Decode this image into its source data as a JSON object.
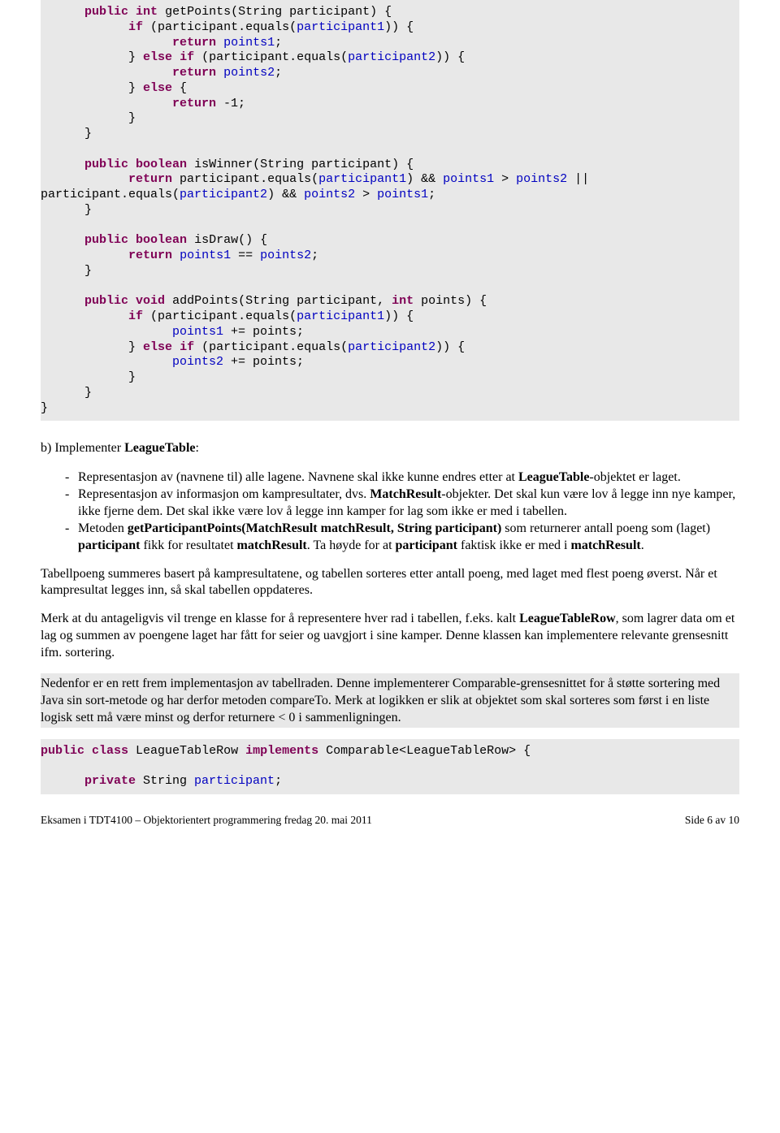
{
  "code1": {
    "l01a": "      ",
    "l01b": "public",
    "l01c": " ",
    "l01d": "int",
    "l01e": " getPoints(String participant) {",
    "l02a": "            ",
    "l02b": "if",
    "l02c": " (participant.equals(",
    "l02d": "participant1",
    "l02e": ")) {",
    "l03a": "                  ",
    "l03b": "return",
    "l03c": " ",
    "l03d": "points1",
    "l03e": ";",
    "l04a": "            } ",
    "l04b": "else",
    "l04c": " ",
    "l04d": "if",
    "l04e": " (participant.equals(",
    "l04f": "participant2",
    "l04g": ")) {",
    "l05a": "                  ",
    "l05b": "return",
    "l05c": " ",
    "l05d": "points2",
    "l05e": ";",
    "l06a": "            } ",
    "l06b": "else",
    "l06c": " {",
    "l07a": "                  ",
    "l07b": "return",
    "l07c": " -1;",
    "l08": "            }",
    "l09": "      }",
    "l10": "",
    "l11a": "      ",
    "l11b": "public",
    "l11c": " ",
    "l11d": "boolean",
    "l11e": " isWinner(String participant) {",
    "l12a": "            ",
    "l12b": "return",
    "l12c": " participant.equals(",
    "l12d": "participant1",
    "l12e": ") && ",
    "l12f": "points1",
    "l12g": " > ",
    "l12h": "points2",
    "l12i": " ||",
    "l13a": "participant.equals(",
    "l13b": "participant2",
    "l13c": ") && ",
    "l13d": "points2",
    "l13e": " > ",
    "l13f": "points1",
    "l13g": ";",
    "l14": "      }",
    "l15": "",
    "l16a": "      ",
    "l16b": "public",
    "l16c": " ",
    "l16d": "boolean",
    "l16e": " isDraw() {",
    "l17a": "            ",
    "l17b": "return",
    "l17c": " ",
    "l17d": "points1",
    "l17e": " == ",
    "l17f": "points2",
    "l17g": ";",
    "l18": "      }",
    "l19": "",
    "l20a": "      ",
    "l20b": "public",
    "l20c": " ",
    "l20d": "void",
    "l20e": " addPoints(String participant, ",
    "l20f": "int",
    "l20g": " points) {",
    "l21a": "            ",
    "l21b": "if",
    "l21c": " (participant.equals(",
    "l21d": "participant1",
    "l21e": ")) {",
    "l22a": "                  ",
    "l22b": "points1",
    "l22c": " += points;",
    "l23a": "            } ",
    "l23b": "else",
    "l23c": " ",
    "l23d": "if",
    "l23e": " (participant.equals(",
    "l23f": "participant2",
    "l23g": ")) {",
    "l24a": "                  ",
    "l24b": "points2",
    "l24c": " += points;",
    "l25": "            }",
    "l26": "      }",
    "l27": "}"
  },
  "b_intro": "b) Implementer ",
  "b_leaguetable": "LeagueTable",
  "b_colon": ":",
  "bullet1a": "Representasjon av (navnene til) alle lagene. Navnene skal ikke kunne endres etter at ",
  "bullet1b": "LeagueTable",
  "bullet1c": "-objektet er laget.",
  "bullet2a": "Representasjon av informasjon om kampresultater, dvs. ",
  "bullet2b": "MatchResult",
  "bullet2c": "-objekter. Det skal kun være lov å legge inn nye kamper, ikke fjerne dem. Det skal ikke være lov å legge inn kamper for lag som ikke er med i tabellen.",
  "bullet3a": "Metoden ",
  "bullet3b": "getParticipantPoints(MatchResult matchResult, String participant)",
  "bullet3c": " som returnerer antall poeng som (laget) ",
  "bullet3d": "participant",
  "bullet3e": " fikk for resultatet ",
  "bullet3f": "matchResult",
  "bullet3g": ". Ta høyde for at ",
  "bullet3h": "participant",
  "bullet3i": " faktisk ikke er med i ",
  "bullet3j": "matchResult",
  "bullet3k": ".",
  "p2": "Tabellpoeng summeres basert på kampresultatene, og tabellen sorteres etter antall poeng, med laget med flest poeng øverst. Når et kampresultat legges inn, så skal tabellen oppdateres.",
  "p3a": "Merk at du antageligvis vil trenge en klasse for å representere hver rad i tabellen, f.eks. kalt ",
  "p3b": "LeagueTableRow",
  "p3c": ", som lagrer data om et lag og summen av poengene laget har fått for seier og uavgjort i sine kamper. Denne klassen kan implementere relevante grensesnitt ifm. sortering.",
  "gray_para": "Nedenfor er en rett frem implementasjon av tabellraden. Denne implementerer Comparable-grensesnittet for å støtte sortering med Java sin sort-metode og har derfor metoden compareTo. Merk at logikken er slik at objektet som skal sorteres som først i en liste logisk sett må være minst og derfor returnere < 0 i sammenligningen.",
  "code2": {
    "l1a": "public",
    "l1b": " ",
    "l1c": "class",
    "l1d": " LeagueTableRow ",
    "l1e": "implements",
    "l1f": " Comparable<LeagueTableRow> {",
    "l2": "",
    "l3a": "      ",
    "l3b": "private",
    "l3c": " String ",
    "l3d": "participant",
    "l3e": ";"
  },
  "footer_left": "Eksamen i TDT4100 – Objektorientert programmering fredag 20. mai 2011",
  "footer_right": "Side 6 av 10"
}
